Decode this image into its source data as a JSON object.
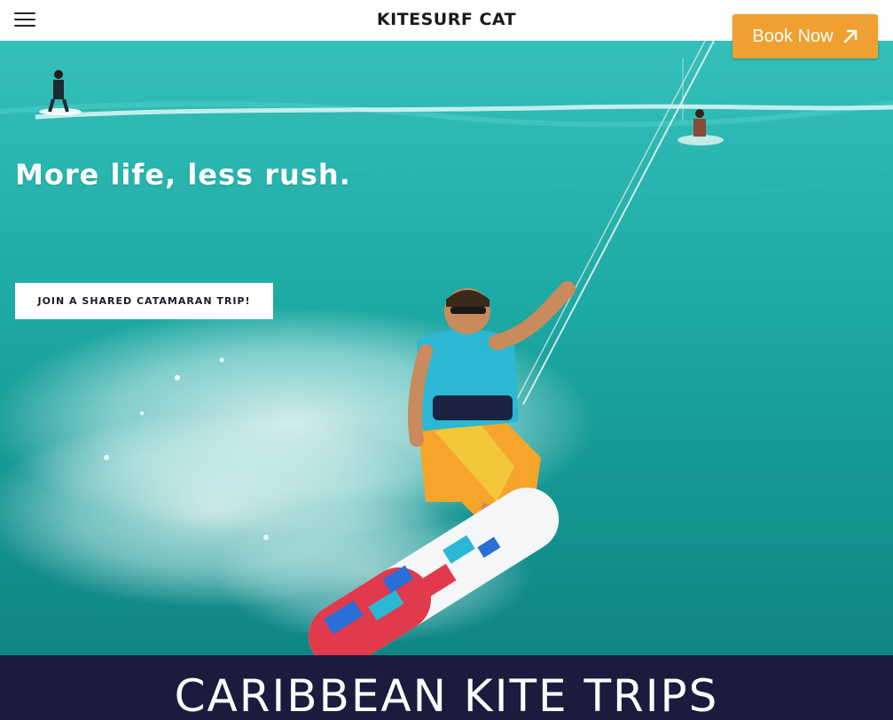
{
  "header": {
    "site_title": "KITESURF CAT",
    "menu_icon": "hamburger-menu-icon",
    "book_now_label": "Book Now",
    "book_now_icon": "external-arrow-icon",
    "book_now_color": "#f0a030"
  },
  "hero": {
    "heading": "More life, less rush.",
    "cta_label": "JOIN A SHARED CATAMARAN TRIP!",
    "image_alt": "Kitesurfer riding a board over turquoise water"
  },
  "section": {
    "title": "CARIBBEAN KITE TRIPS",
    "background_color": "#1a1b3d"
  },
  "colors": {
    "water": "#1aa39f",
    "text_dark": "#1a1a1a",
    "white": "#ffffff"
  }
}
